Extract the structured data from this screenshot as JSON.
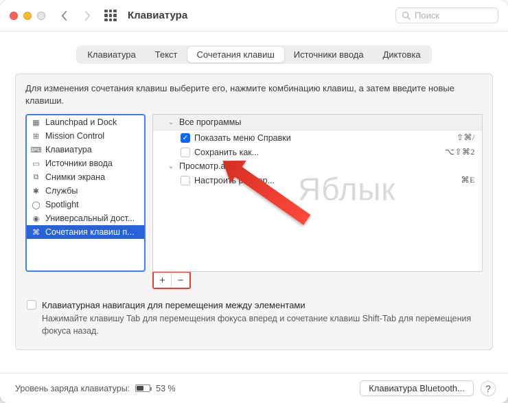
{
  "window": {
    "title": "Клавиатура"
  },
  "search": {
    "placeholder": "Поиск"
  },
  "tabs": [
    "Клавиатура",
    "Текст",
    "Сочетания клавиш",
    "Источники ввода",
    "Диктовка"
  ],
  "active_tab_index": 2,
  "panel": {
    "description": "Для изменения сочетания клавиш выберите его, нажмите комбинацию клавиш, а затем введите новые клавиши."
  },
  "categories": [
    {
      "icon": "launchpad",
      "label": "Launchpad и Dock"
    },
    {
      "icon": "mission",
      "label": "Mission Control"
    },
    {
      "icon": "keyboard",
      "label": "Клавиатура"
    },
    {
      "icon": "input",
      "label": "Источники ввода"
    },
    {
      "icon": "screenshot",
      "label": "Снимки экрана"
    },
    {
      "icon": "services",
      "label": "Службы"
    },
    {
      "icon": "spotlight",
      "label": "Spotlight"
    },
    {
      "icon": "a11y",
      "label": "Универсальный дост..."
    },
    {
      "icon": "apps",
      "label": "Сочетания клавиш п..."
    }
  ],
  "selected_category_index": 8,
  "shortcuts": {
    "groups": [
      {
        "name": "Все программы",
        "items": [
          {
            "checked": true,
            "label": "Показать меню Справки",
            "keys": "⇧⌘/"
          },
          {
            "checked": false,
            "label": "Сохранить как...",
            "keys": "⌥⇧⌘2"
          }
        ]
      },
      {
        "name": "Просмотр.app",
        "items": [
          {
            "checked": false,
            "label": "Настроить размер...",
            "keys": "⌘E"
          }
        ]
      }
    ]
  },
  "keyboard_nav": {
    "checkbox_label": "Клавиатурная навигация для перемещения между элементами",
    "hint": "Нажимайте клавишу Tab для перемещения фокуса вперед и сочетание клавиш Shift-Tab для перемещения фокуса назад."
  },
  "footer": {
    "battery_label": "Уровень заряда клавиатуры:",
    "battery_percent": "53 %",
    "bluetooth_button": "Клавиатура Bluetooth..."
  },
  "watermark": "Яблык"
}
